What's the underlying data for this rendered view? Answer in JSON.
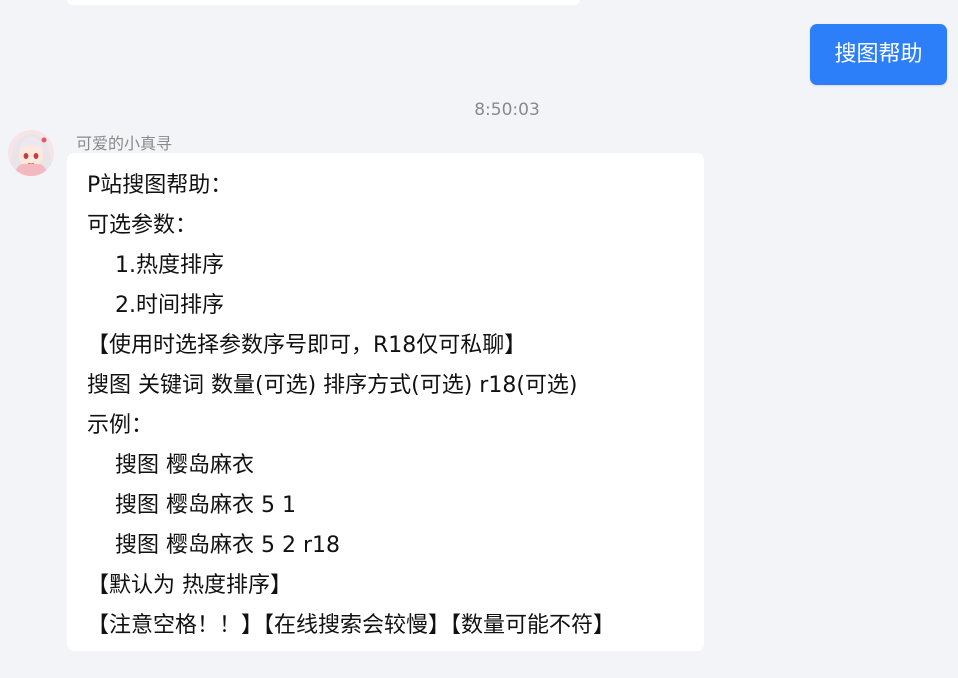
{
  "chat": {
    "sent_message": "搜图帮助",
    "timestamp": "8:50:03",
    "sender_name": "可爱的小真寻",
    "reply_lines": [
      "P站搜图帮助：",
      "可选参数：",
      "1.热度排序",
      "2.时间排序",
      "【使用时选择参数序号即可，R18仅可私聊】",
      "搜图 关键词 数量(可选) 排序方式(可选) r18(可选)",
      "示例：",
      "搜图 樱岛麻衣",
      "搜图 樱岛麻衣 5 1",
      "搜图 樱岛麻衣 5 2 r18",
      "【默认为 热度排序】",
      "【注意空格！！】【在线搜索会较慢】【数量可能不符】"
    ]
  },
  "colors": {
    "page_background": "#f3f4f7",
    "sent_bubble": "#2d7ff9",
    "received_bubble": "#ffffff"
  }
}
